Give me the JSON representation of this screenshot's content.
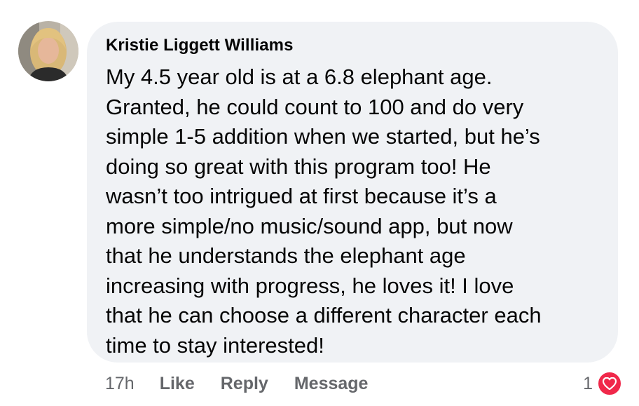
{
  "comment": {
    "author": "Kristie Liggett Williams",
    "text": "My 4.5 year old is at a 6.8 elephant age.\nGranted, he could count to 100 and do very\nsimple 1-5 addition when we started, but he’s\ndoing so great with this program too! He\nwasn’t too intrigued at first because it’s a\nmore simple/no music/sound app, but now\nthat he understands the elephant age\nincreasing with progress, he loves it! I love\nthat he can choose a different character each\ntime to stay interested!"
  },
  "actions": {
    "timestamp": "17h",
    "like_label": "Like",
    "reply_label": "Reply",
    "message_label": "Message"
  },
  "reactions": {
    "count": "1",
    "icon": "heart-icon",
    "color": "#f0284a"
  }
}
